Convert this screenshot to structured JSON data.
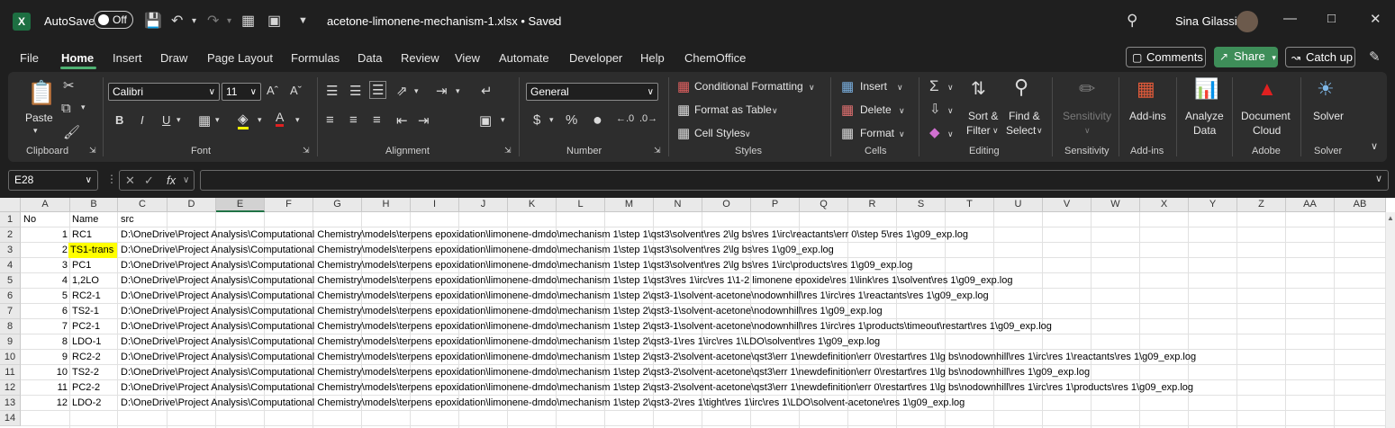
{
  "titlebar": {
    "autosave_label": "AutoSave",
    "autosave_state": "Off",
    "document_title": "acetone-limonene-mechanism-1.xlsx • Saved",
    "user_name": "Sina Gilassi"
  },
  "menu": {
    "tabs": [
      "File",
      "Home",
      "Insert",
      "Draw",
      "Page Layout",
      "Formulas",
      "Data",
      "Review",
      "View",
      "Automate",
      "Developer",
      "Help",
      "ChemOffice"
    ],
    "active": "Home"
  },
  "header_buttons": {
    "comments": "Comments",
    "share": "Share",
    "catchup": "Catch up"
  },
  "ribbon": {
    "clipboard": {
      "label": "Clipboard",
      "paste": "Paste"
    },
    "font": {
      "label": "Font",
      "family": "Calibri",
      "size": "11"
    },
    "alignment": {
      "label": "Alignment"
    },
    "number": {
      "label": "Number",
      "format": "General"
    },
    "styles": {
      "label": "Styles",
      "conditional": "Conditional Formatting",
      "format_table": "Format as Table",
      "cell_styles": "Cell Styles"
    },
    "cells": {
      "label": "Cells",
      "insert": "Insert",
      "delete": "Delete",
      "format": "Format"
    },
    "editing": {
      "label": "Editing",
      "sort1": "Sort &",
      "sort2": "Filter",
      "find1": "Find &",
      "find2": "Select"
    },
    "sensitivity": {
      "label": "Sensitivity",
      "button": "Sensitivity"
    },
    "addins": {
      "label": "Add-ins",
      "button": "Add-ins"
    },
    "analyze": {
      "button1": "Analyze",
      "button2": "Data"
    },
    "adobe": {
      "label": "Adobe",
      "button1": "Document",
      "button2": "Cloud"
    },
    "solver": {
      "label": "Solver",
      "button": "Solver"
    }
  },
  "formula_bar": {
    "name_box": "E28",
    "fx": "fx",
    "content": ""
  },
  "sheet": {
    "columns": [
      "A",
      "B",
      "C",
      "D",
      "E",
      "F",
      "G",
      "H",
      "I",
      "J",
      "K",
      "L",
      "M",
      "N",
      "O",
      "P",
      "Q",
      "R",
      "S",
      "T",
      "U",
      "V",
      "W",
      "X",
      "Y",
      "Z",
      "AA",
      "AB"
    ],
    "selected_column": "E",
    "row_numbers": [
      "1",
      "2",
      "3",
      "4",
      "5",
      "6",
      "7",
      "8",
      "9",
      "10",
      "11",
      "12",
      "13",
      "14"
    ],
    "header": {
      "a": "No",
      "b": "Name",
      "c": "src"
    },
    "rows": [
      {
        "no": "1",
        "name": "RC1",
        "src": "D:\\OneDrive\\Project Analysis\\Computational Chemistry\\models\\terpens epoxidation\\limonene-dmdo\\mechanism 1\\step 1\\qst3\\solvent\\res 2\\lg bs\\res 1\\irc\\reactants\\err 0\\step 5\\res 1\\g09_exp.log"
      },
      {
        "no": "2",
        "name": "TS1-trans",
        "src": "D:\\OneDrive\\Project Analysis\\Computational Chemistry\\models\\terpens epoxidation\\limonene-dmdo\\mechanism 1\\step 1\\qst3\\solvent\\res 2\\lg bs\\res 1\\g09_exp.log"
      },
      {
        "no": "3",
        "name": "PC1",
        "src": "D:\\OneDrive\\Project Analysis\\Computational Chemistry\\models\\terpens epoxidation\\limonene-dmdo\\mechanism 1\\step 1\\qst3\\solvent\\res 2\\lg bs\\res 1\\irc\\products\\res 1\\g09_exp.log"
      },
      {
        "no": "4",
        "name": "1,2LO",
        "src": "D:\\OneDrive\\Project Analysis\\Computational Chemistry\\models\\terpens epoxidation\\limonene-dmdo\\mechanism 1\\step 1\\qst3\\res 1\\irc\\res 1\\1-2 limonene epoxide\\res 1\\link\\res 1\\solvent\\res 1\\g09_exp.log"
      },
      {
        "no": "5",
        "name": "RC2-1",
        "src": "D:\\OneDrive\\Project Analysis\\Computational Chemistry\\models\\terpens epoxidation\\limonene-dmdo\\mechanism 1\\step 2\\qst3-1\\solvent-acetone\\nodownhill\\res 1\\irc\\res 1\\reactants\\res 1\\g09_exp.log"
      },
      {
        "no": "6",
        "name": "TS2-1",
        "src": "D:\\OneDrive\\Project Analysis\\Computational Chemistry\\models\\terpens epoxidation\\limonene-dmdo\\mechanism 1\\step 2\\qst3-1\\solvent-acetone\\nodownhill\\res 1\\g09_exp.log"
      },
      {
        "no": "7",
        "name": "PC2-1",
        "src": "D:\\OneDrive\\Project Analysis\\Computational Chemistry\\models\\terpens epoxidation\\limonene-dmdo\\mechanism 1\\step 2\\qst3-1\\solvent-acetone\\nodownhill\\res 1\\irc\\res 1\\products\\timeout\\restart\\res 1\\g09_exp.log"
      },
      {
        "no": "8",
        "name": "LDO-1",
        "src": "D:\\OneDrive\\Project Analysis\\Computational Chemistry\\models\\terpens epoxidation\\limonene-dmdo\\mechanism 1\\step 2\\qst3-1\\res 1\\irc\\res 1\\LDO\\solvent\\res 1\\g09_exp.log"
      },
      {
        "no": "9",
        "name": "RC2-2",
        "src": "D:\\OneDrive\\Project Analysis\\Computational Chemistry\\models\\terpens epoxidation\\limonene-dmdo\\mechanism 1\\step 2\\qst3-2\\solvent-acetone\\qst3\\err 1\\newdefinition\\err 0\\restart\\res 1\\lg bs\\nodownhill\\res 1\\irc\\res 1\\reactants\\res 1\\g09_exp.log"
      },
      {
        "no": "10",
        "name": "TS2-2",
        "src": "D:\\OneDrive\\Project Analysis\\Computational Chemistry\\models\\terpens epoxidation\\limonene-dmdo\\mechanism 1\\step 2\\qst3-2\\solvent-acetone\\qst3\\err 1\\newdefinition\\err 0\\restart\\res 1\\lg bs\\nodownhill\\res 1\\g09_exp.log"
      },
      {
        "no": "11",
        "name": "PC2-2",
        "src": "D:\\OneDrive\\Project Analysis\\Computational Chemistry\\models\\terpens epoxidation\\limonene-dmdo\\mechanism 1\\step 2\\qst3-2\\solvent-acetone\\qst3\\err 1\\newdefinition\\err 0\\restart\\res 1\\lg bs\\nodownhill\\res 1\\irc\\res 1\\products\\res 1\\g09_exp.log"
      },
      {
        "no": "12",
        "name": "LDO-2",
        "src": "D:\\OneDrive\\Project Analysis\\Computational Chemistry\\models\\terpens epoxidation\\limonene-dmdo\\mechanism 1\\step 2\\qst3-2\\res 1\\tight\\res 1\\irc\\res 1\\LDO\\solvent-acetone\\res 1\\g09_exp.log"
      }
    ],
    "highlight_color": "#ffff00"
  }
}
